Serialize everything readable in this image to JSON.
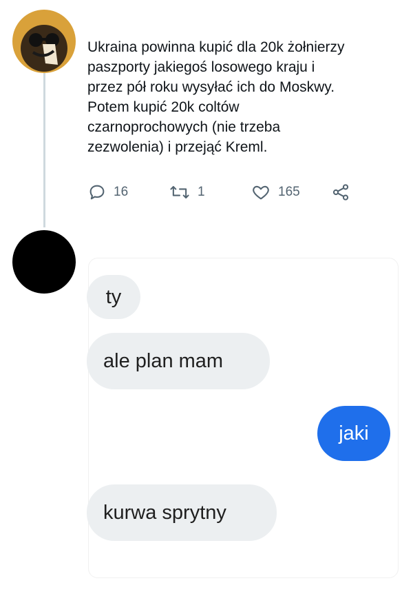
{
  "tweet": {
    "text": "Ukraina powinna kupić dla 20k żołnierzy\npaszporty jakiegoś losowego kraju i\nprzez pół roku wysyłać ich do Moskwy.\nPotem kupić 20k coltów\nczarnoprochowych (nie trzeba\nzezwolenia) i przejąć Kreml.",
    "actions": {
      "reply": {
        "icon": "reply-icon",
        "count": "16"
      },
      "retweet": {
        "icon": "retweet-icon",
        "count": "1"
      },
      "like": {
        "icon": "heart-icon",
        "count": "165"
      },
      "share": {
        "icon": "share-icon"
      }
    }
  },
  "chat": {
    "messages": [
      {
        "from": "them",
        "text": "ty"
      },
      {
        "from": "them",
        "text": "ale plan mam"
      },
      {
        "from": "me",
        "text": "jaki"
      },
      {
        "from": "them",
        "text": "kurwa sprytny"
      }
    ]
  },
  "colors": {
    "thread_line": "#cfd9de",
    "action_gray": "#536471",
    "outgoing_bubble": "#1f6feb",
    "incoming_bubble": "#eceff1"
  }
}
